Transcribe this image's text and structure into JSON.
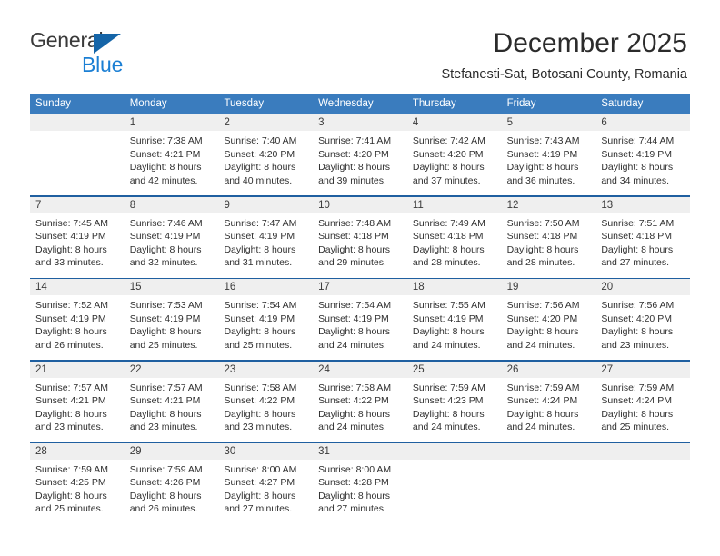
{
  "brand": {
    "name_top": "General",
    "name_bottom": "Blue",
    "accent_color": "#1b7fd4",
    "triangle_color": "#1565a8"
  },
  "header": {
    "title": "December 2025",
    "subtitle": "Stefanesti-Sat, Botosani County, Romania"
  },
  "theme": {
    "header_band": "#3a7cbe",
    "week_rule": "#1f5fa0",
    "day_band": "#efefef",
    "text": "#2f2f2f"
  },
  "calendar": {
    "weekdays": [
      "Sunday",
      "Monday",
      "Tuesday",
      "Wednesday",
      "Thursday",
      "Friday",
      "Saturday"
    ],
    "weeks": [
      [
        {
          "day": "",
          "lines": []
        },
        {
          "day": "1",
          "lines": [
            "Sunrise: 7:38 AM",
            "Sunset: 4:21 PM",
            "Daylight: 8 hours",
            "and 42 minutes."
          ]
        },
        {
          "day": "2",
          "lines": [
            "Sunrise: 7:40 AM",
            "Sunset: 4:20 PM",
            "Daylight: 8 hours",
            "and 40 minutes."
          ]
        },
        {
          "day": "3",
          "lines": [
            "Sunrise: 7:41 AM",
            "Sunset: 4:20 PM",
            "Daylight: 8 hours",
            "and 39 minutes."
          ]
        },
        {
          "day": "4",
          "lines": [
            "Sunrise: 7:42 AM",
            "Sunset: 4:20 PM",
            "Daylight: 8 hours",
            "and 37 minutes."
          ]
        },
        {
          "day": "5",
          "lines": [
            "Sunrise: 7:43 AM",
            "Sunset: 4:19 PM",
            "Daylight: 8 hours",
            "and 36 minutes."
          ]
        },
        {
          "day": "6",
          "lines": [
            "Sunrise: 7:44 AM",
            "Sunset: 4:19 PM",
            "Daylight: 8 hours",
            "and 34 minutes."
          ]
        }
      ],
      [
        {
          "day": "7",
          "lines": [
            "Sunrise: 7:45 AM",
            "Sunset: 4:19 PM",
            "Daylight: 8 hours",
            "and 33 minutes."
          ]
        },
        {
          "day": "8",
          "lines": [
            "Sunrise: 7:46 AM",
            "Sunset: 4:19 PM",
            "Daylight: 8 hours",
            "and 32 minutes."
          ]
        },
        {
          "day": "9",
          "lines": [
            "Sunrise: 7:47 AM",
            "Sunset: 4:19 PM",
            "Daylight: 8 hours",
            "and 31 minutes."
          ]
        },
        {
          "day": "10",
          "lines": [
            "Sunrise: 7:48 AM",
            "Sunset: 4:18 PM",
            "Daylight: 8 hours",
            "and 29 minutes."
          ]
        },
        {
          "day": "11",
          "lines": [
            "Sunrise: 7:49 AM",
            "Sunset: 4:18 PM",
            "Daylight: 8 hours",
            "and 28 minutes."
          ]
        },
        {
          "day": "12",
          "lines": [
            "Sunrise: 7:50 AM",
            "Sunset: 4:18 PM",
            "Daylight: 8 hours",
            "and 28 minutes."
          ]
        },
        {
          "day": "13",
          "lines": [
            "Sunrise: 7:51 AM",
            "Sunset: 4:18 PM",
            "Daylight: 8 hours",
            "and 27 minutes."
          ]
        }
      ],
      [
        {
          "day": "14",
          "lines": [
            "Sunrise: 7:52 AM",
            "Sunset: 4:19 PM",
            "Daylight: 8 hours",
            "and 26 minutes."
          ]
        },
        {
          "day": "15",
          "lines": [
            "Sunrise: 7:53 AM",
            "Sunset: 4:19 PM",
            "Daylight: 8 hours",
            "and 25 minutes."
          ]
        },
        {
          "day": "16",
          "lines": [
            "Sunrise: 7:54 AM",
            "Sunset: 4:19 PM",
            "Daylight: 8 hours",
            "and 25 minutes."
          ]
        },
        {
          "day": "17",
          "lines": [
            "Sunrise: 7:54 AM",
            "Sunset: 4:19 PM",
            "Daylight: 8 hours",
            "and 24 minutes."
          ]
        },
        {
          "day": "18",
          "lines": [
            "Sunrise: 7:55 AM",
            "Sunset: 4:19 PM",
            "Daylight: 8 hours",
            "and 24 minutes."
          ]
        },
        {
          "day": "19",
          "lines": [
            "Sunrise: 7:56 AM",
            "Sunset: 4:20 PM",
            "Daylight: 8 hours",
            "and 24 minutes."
          ]
        },
        {
          "day": "20",
          "lines": [
            "Sunrise: 7:56 AM",
            "Sunset: 4:20 PM",
            "Daylight: 8 hours",
            "and 23 minutes."
          ]
        }
      ],
      [
        {
          "day": "21",
          "lines": [
            "Sunrise: 7:57 AM",
            "Sunset: 4:21 PM",
            "Daylight: 8 hours",
            "and 23 minutes."
          ]
        },
        {
          "day": "22",
          "lines": [
            "Sunrise: 7:57 AM",
            "Sunset: 4:21 PM",
            "Daylight: 8 hours",
            "and 23 minutes."
          ]
        },
        {
          "day": "23",
          "lines": [
            "Sunrise: 7:58 AM",
            "Sunset: 4:22 PM",
            "Daylight: 8 hours",
            "and 23 minutes."
          ]
        },
        {
          "day": "24",
          "lines": [
            "Sunrise: 7:58 AM",
            "Sunset: 4:22 PM",
            "Daylight: 8 hours",
            "and 24 minutes."
          ]
        },
        {
          "day": "25",
          "lines": [
            "Sunrise: 7:59 AM",
            "Sunset: 4:23 PM",
            "Daylight: 8 hours",
            "and 24 minutes."
          ]
        },
        {
          "day": "26",
          "lines": [
            "Sunrise: 7:59 AM",
            "Sunset: 4:24 PM",
            "Daylight: 8 hours",
            "and 24 minutes."
          ]
        },
        {
          "day": "27",
          "lines": [
            "Sunrise: 7:59 AM",
            "Sunset: 4:24 PM",
            "Daylight: 8 hours",
            "and 25 minutes."
          ]
        }
      ],
      [
        {
          "day": "28",
          "lines": [
            "Sunrise: 7:59 AM",
            "Sunset: 4:25 PM",
            "Daylight: 8 hours",
            "and 25 minutes."
          ]
        },
        {
          "day": "29",
          "lines": [
            "Sunrise: 7:59 AM",
            "Sunset: 4:26 PM",
            "Daylight: 8 hours",
            "and 26 minutes."
          ]
        },
        {
          "day": "30",
          "lines": [
            "Sunrise: 8:00 AM",
            "Sunset: 4:27 PM",
            "Daylight: 8 hours",
            "and 27 minutes."
          ]
        },
        {
          "day": "31",
          "lines": [
            "Sunrise: 8:00 AM",
            "Sunset: 4:28 PM",
            "Daylight: 8 hours",
            "and 27 minutes."
          ]
        },
        {
          "day": "",
          "lines": []
        },
        {
          "day": "",
          "lines": []
        },
        {
          "day": "",
          "lines": []
        }
      ]
    ]
  }
}
